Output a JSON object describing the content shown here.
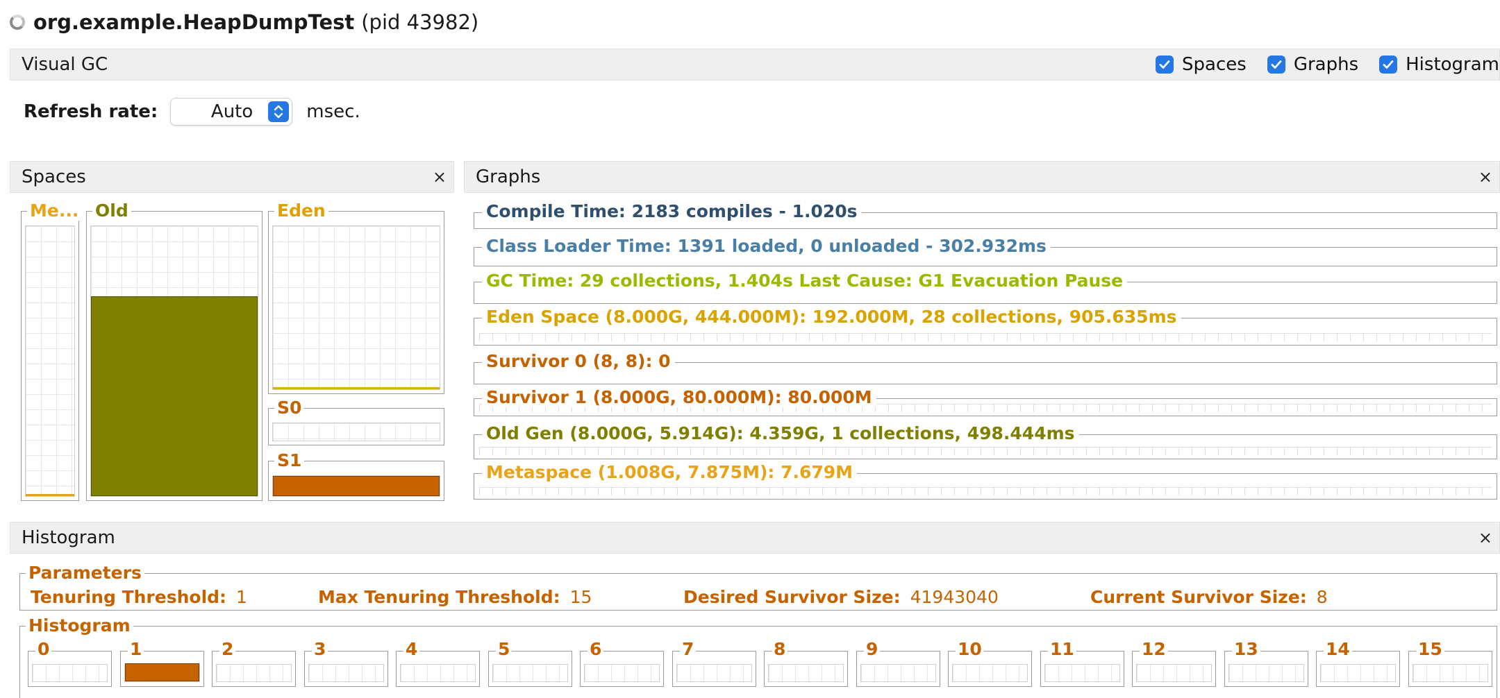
{
  "window": {
    "class_name": "org.example.HeapDumpTest",
    "pid": "(pid 43982)"
  },
  "visual_gc": {
    "title": "Visual GC",
    "checkboxes": [
      {
        "label": "Spaces",
        "checked": true
      },
      {
        "label": "Graphs",
        "checked": true
      },
      {
        "label": "Histogram",
        "checked": true
      }
    ]
  },
  "refresh": {
    "label": "Refresh rate:",
    "value": "Auto",
    "unit": "msec."
  },
  "spaces": {
    "title": "Spaces",
    "close": "×",
    "metaspace": {
      "label": "Me...",
      "fill": 0.01,
      "color": "#e8a317"
    },
    "old": {
      "label": "Old",
      "fill": 0.74,
      "color": "#808000"
    },
    "eden": {
      "label": "Eden",
      "fill": 0.01,
      "color": "#e0b000"
    },
    "s0": {
      "label": "S0",
      "fill": 0.0,
      "color": "#c46300"
    },
    "s1": {
      "label": "S1",
      "fill": 1.0,
      "color": "#c46300"
    }
  },
  "graphs": {
    "title": "Graphs",
    "close": "×",
    "rows": [
      {
        "label": "Compile Time: 2183 compiles - 1.020s",
        "color": "#2f4f6f"
      },
      {
        "label": "Class Loader Time: 1391 loaded, 0 unloaded - 302.932ms",
        "color": "#4a7fa5"
      },
      {
        "label": "GC Time: 29 collections, 1.404s  Last Cause: G1 Evacuation Pause",
        "color": "#9aba00"
      },
      {
        "label": "Eden Space (8.000G, 444.000M): 192.000M, 28 collections, 905.635ms",
        "color": "#d9a400"
      },
      {
        "label": "Survivor 0 (8, 8): 0",
        "color": "#c46300"
      },
      {
        "label": "Survivor 1 (8.000G, 80.000M): 80.000M",
        "color": "#c46300"
      },
      {
        "label": "Old Gen (8.000G, 5.914G): 4.359G, 1 collections, 498.444ms",
        "color": "#808000"
      },
      {
        "label": "Metaspace (1.008G, 7.875M): 7.679M",
        "color": "#e8a317"
      }
    ]
  },
  "histogram": {
    "title": "Histogram",
    "close": "×",
    "parameters_title": "Parameters",
    "parameters": [
      {
        "label": "Tenuring Threshold:",
        "value": "1"
      },
      {
        "label": "Max Tenuring Threshold:",
        "value": "15"
      },
      {
        "label": "Desired Survivor Size:",
        "value": "41943040"
      },
      {
        "label": "Current Survivor Size:",
        "value": "8"
      }
    ],
    "histogram_title": "Histogram",
    "cells": [
      {
        "label": "0",
        "fill": 0
      },
      {
        "label": "1",
        "fill": 1
      },
      {
        "label": "2",
        "fill": 0
      },
      {
        "label": "3",
        "fill": 0
      },
      {
        "label": "4",
        "fill": 0
      },
      {
        "label": "5",
        "fill": 0
      },
      {
        "label": "6",
        "fill": 0
      },
      {
        "label": "7",
        "fill": 0
      },
      {
        "label": "8",
        "fill": 0
      },
      {
        "label": "9",
        "fill": 0
      },
      {
        "label": "10",
        "fill": 0
      },
      {
        "label": "11",
        "fill": 0
      },
      {
        "label": "12",
        "fill": 0
      },
      {
        "label": "13",
        "fill": 0
      },
      {
        "label": "14",
        "fill": 0
      },
      {
        "label": "15",
        "fill": 0
      }
    ],
    "color": "#c46300"
  }
}
